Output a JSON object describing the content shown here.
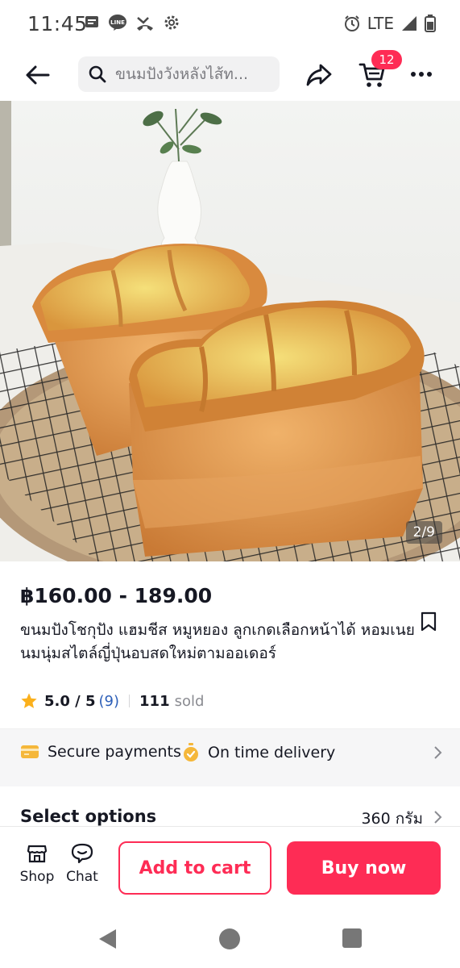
{
  "status_bar": {
    "time": "11:45",
    "network": "LTE",
    "icons_left": [
      "message-icon",
      "line-app-icon",
      "missed-call-icon",
      "settings-gear-icon"
    ],
    "icons_right": [
      "alarm-icon",
      "signal-icon",
      "battery-icon"
    ]
  },
  "topnav": {
    "search_placeholder": "ขนมปังวังหลังไส้ท...",
    "cart_count": "12"
  },
  "product": {
    "image_counter": "2/9",
    "price": "฿160.00 - 189.00",
    "title": "ขนมปังโชกุปัง แฮมชีส หมูหยอง ลูกเกดเลือกหน้าได้ หอมเนยนมนุ่มสไตล์ญี่ปุ่นอบสดใหม่ตามออเดอร์",
    "rating": "5.0 / 5",
    "rating_count": "(9)",
    "sold_count": "111",
    "sold_label": "sold"
  },
  "assurance": {
    "secure_label": "Secure payments",
    "delivery_label": "On time delivery"
  },
  "options": {
    "label": "Select options",
    "value": "360 กรัม"
  },
  "bottom_bar": {
    "shop_label": "Shop",
    "chat_label": "Chat",
    "add_to_cart": "Add to cart",
    "buy_now": "Buy now"
  },
  "colors": {
    "accent": "#fe2c55",
    "star": "#fbb01c",
    "link": "#2d5fb8"
  }
}
